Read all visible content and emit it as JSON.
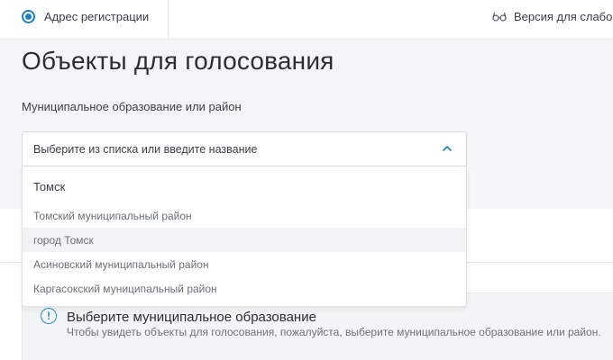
{
  "header": {
    "address_label": "Адрес регистрации",
    "accessibility_label": "Версия для слабовидящих"
  },
  "page": {
    "title": "Объекты для голосования",
    "field_label": "Муниципальное образование или район"
  },
  "select": {
    "placeholder": "Выберите из списка или введите название",
    "search_value": "Томск",
    "options": [
      "Томский муниципальный район",
      "город Томск",
      "Асиновский муниципальный район",
      "Каргасокский муниципальный район"
    ],
    "highlighted_option": "город Томск"
  },
  "info": {
    "title": "Выберите муниципальное образование",
    "subtitle": "Чтобы увидеть объекты для голосования, пожалуйста, выберите муниципальное образование или район."
  },
  "colors": {
    "accent": "#1c7fc6",
    "info_icon": "#2a8fd0",
    "background": "#f4f5f6"
  }
}
